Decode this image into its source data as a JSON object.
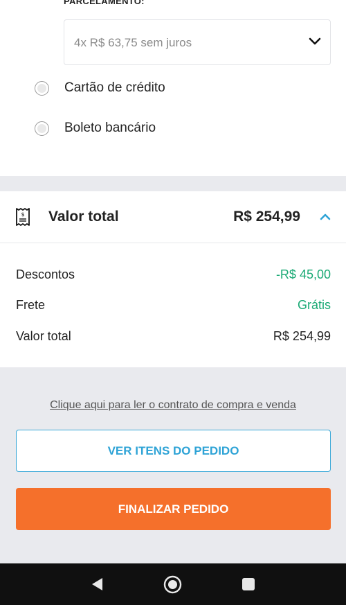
{
  "payment": {
    "installment_label": "PARCELAMENTO:",
    "installment_selected": "4x R$ 63,75 sem juros",
    "options": [
      {
        "label": "Cartão de crédito",
        "selected": false
      },
      {
        "label": "Boleto bancário",
        "selected": false
      }
    ]
  },
  "summary": {
    "title": "Valor total",
    "amount": "R$ 254,99",
    "rows": [
      {
        "label": "Descontos",
        "value": "-R$ 45,00",
        "color": "#19a974"
      },
      {
        "label": "Frete",
        "value": "Grátis",
        "color": "#19a974"
      },
      {
        "label": "Valor total",
        "value": "R$ 254,99",
        "color": "#222222"
      }
    ]
  },
  "actions": {
    "contract_link": "Clique aqui para ler o contrato de compra e venda",
    "view_items": "VER ITENS DO PEDIDO",
    "finalize": "FINALIZAR PEDIDO"
  },
  "colors": {
    "accent_blue": "#2ea3d6",
    "primary_orange": "#f5702b",
    "success_green": "#19a974"
  },
  "icons": {
    "select_arrow": "chevron-down-icon",
    "receipt": "receipt-icon",
    "collapse": "chevron-up-icon",
    "nav_back": "back-triangle-icon",
    "nav_home": "home-circle-icon",
    "nav_recent": "recent-square-icon"
  }
}
